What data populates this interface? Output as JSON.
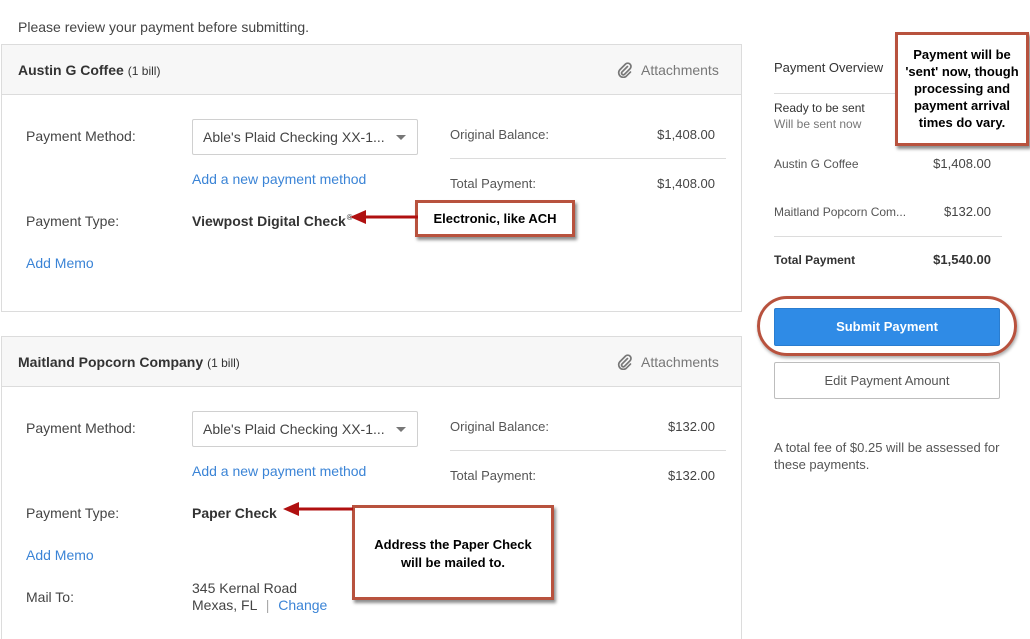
{
  "intro": "Please review your payment before submitting.",
  "attachments_label": "Attachments",
  "payments": [
    {
      "vendor": "Austin G Coffee",
      "bills": "(1 bill)",
      "payment_method_label": "Payment Method:",
      "payment_method_value": "Able's Plaid Checking XX-1...",
      "add_method_link": "Add a new payment method",
      "payment_type_label": "Payment Type:",
      "payment_type_value": "Viewpost Digital Check",
      "payment_type_mark": "®",
      "add_memo": "Add Memo",
      "original_balance_label": "Original Balance:",
      "original_balance": "$1,408.00",
      "total_payment_label": "Total Payment:",
      "total_payment": "$1,408.00"
    },
    {
      "vendor": "Maitland Popcorn Company",
      "bills": "(1 bill)",
      "payment_method_label": "Payment Method:",
      "payment_method_value": "Able's Plaid Checking XX-1...",
      "add_method_link": "Add a new payment method",
      "payment_type_label": "Payment Type:",
      "payment_type_value": "Paper Check",
      "add_memo": "Add Memo",
      "mail_to_label": "Mail To:",
      "address_line1": "345 Kernal Road",
      "address_line2": "Mexas, FL",
      "address_sep": "|",
      "change_link": "Change",
      "original_balance_label": "Original Balance:",
      "original_balance": "$132.00",
      "total_payment_label": "Total Payment:",
      "total_payment": "$132.00"
    }
  ],
  "overview": {
    "title": "Payment Overview",
    "status": "Ready to be sent",
    "status_sub": "Will be sent now",
    "rows": [
      {
        "name": "Austin G Coffee",
        "amount": "$1,408.00"
      },
      {
        "name": "Maitland Popcorn Com...",
        "amount": "$132.00"
      }
    ],
    "total_label": "Total Payment",
    "total": "$1,540.00"
  },
  "actions": {
    "submit": "Submit Payment",
    "edit": "Edit Payment Amount"
  },
  "fee_note": "A total fee of $0.25 will be assessed for these payments.",
  "annotations": {
    "sent_now": "Payment will be 'sent' now, though processing and payment arrival times do vary.",
    "electronic": "Electronic, like ACH",
    "paper_check": "Address the Paper Check will be mailed to."
  },
  "colors": {
    "link": "#3b84d6",
    "primary_button": "#2f8be6",
    "annotation": "#b8523e",
    "arrow": "#b01010"
  },
  "icons": {
    "attachment": "paperclip-icon",
    "select_caret": "chevron-down-icon"
  }
}
